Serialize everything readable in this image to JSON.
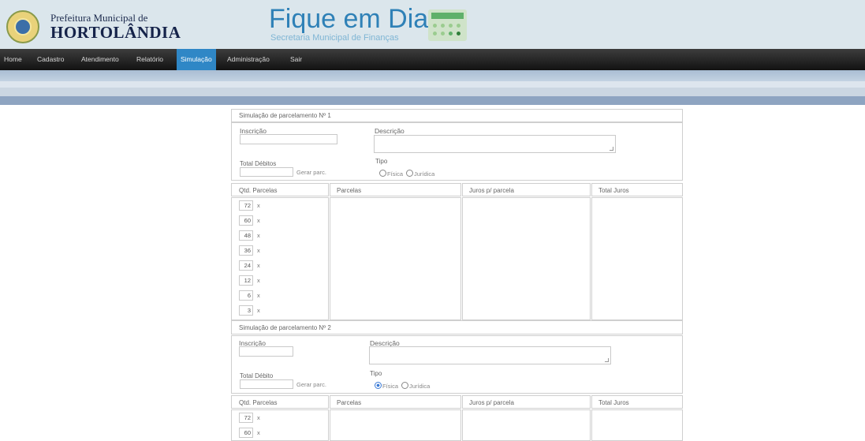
{
  "header": {
    "pref_small": "Prefeitura Municipal de",
    "pref_big": "HORTOLÂNDIA",
    "app_title": "Fique em Dia",
    "app_subtitle": "Secretaria Municipal de Finanças",
    "seal_icon": "city-seal-icon",
    "calc_icon": "calculator-icon"
  },
  "nav": {
    "items": [
      "Home",
      "Cadastro",
      "Atendimento",
      "Relatório",
      "Simulação",
      "Administração",
      "Sair"
    ],
    "active": "Simulação"
  },
  "colors": {
    "accent": "#2f87c6",
    "nav_bg": "#1f1f1f",
    "title": "#2f81b7"
  },
  "sim1": {
    "title": "Simulação de parcelamento Nº 1",
    "inscricao_label": "Inscrição",
    "descricao_label": "Descrição",
    "total_label": "Total Débitos",
    "gerar_label": "Gerar parc.",
    "tipo_label": "Tipo",
    "fisica": "Física",
    "juridica": "Jurídica",
    "selected_tipo": "",
    "headers": [
      "Qtd. Parcelas",
      "Parcelas",
      "Juros p/ parcela",
      "Total Juros"
    ],
    "qtd": [
      "72",
      "60",
      "48",
      "36",
      "24",
      "12",
      "6",
      "3"
    ],
    "x_label": "x"
  },
  "sim2": {
    "title": "Simulação de parcelamento Nº 2",
    "inscricao_label": "Inscrição",
    "descricao_label": "Descrição",
    "total_label": "Total Débito",
    "gerar_label": "Gerar parc.",
    "tipo_label": "Tipo",
    "fisica": "Física",
    "juridica": "Jurídica",
    "selected_tipo": "Física",
    "headers": [
      "Qtd. Parcelas",
      "Parcelas",
      "Juros p/ parcela",
      "Total Juros"
    ],
    "qtd": [
      "72",
      "60"
    ],
    "x_label": "x"
  }
}
